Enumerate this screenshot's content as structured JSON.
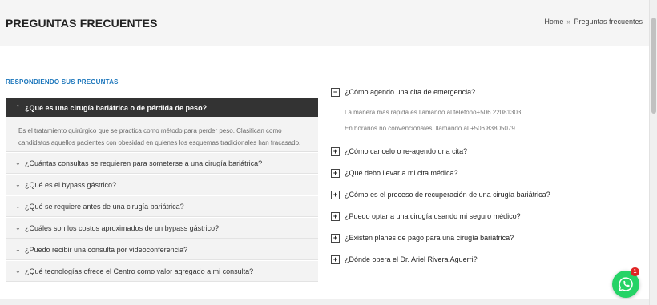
{
  "header": {
    "title": "PREGUNTAS FRECUENTES",
    "breadcrumb_home": "Home",
    "breadcrumb_separator": "»",
    "breadcrumb_current": "Preguntas frecuentes"
  },
  "section": {
    "label": "RESPONDIENDO SUS PREGUNTAS"
  },
  "left_faq": {
    "open_question": "¿Qué es una cirugía bariátrica o de pérdida de peso?",
    "open_answer": "Es el tratamiento quirúrgico que se practica como método para perder peso. Clasifican como candidatos aquellos pacientes con obesidad en quienes los esquemas tradicionales han fracasado.",
    "items": [
      "¿Cuántas consultas se requieren para someterse a una cirugía bariátrica?",
      "¿Qué es el bypass gástrico?",
      "¿Qué se requiere antes de una cirugía bariátrica?",
      "¿Cuáles son los costos aproximados de un bypass gástrico?",
      "¿Puedo recibir una consulta por videoconferencia?",
      "¿Qué tecnologías ofrece el Centro como valor agregado a mi consulta?"
    ]
  },
  "right_faq": {
    "open_question": "¿Cómo agendo una cita de emergencia?",
    "open_answer_lines": [
      "La manera más rápida es llamando al teléfono+506 22081303",
      "En horarios no convencionales, llamando al +506 83805079"
    ],
    "items": [
      "¿Cómo cancelo o re-agendo una cita?",
      "¿Qué debo llevar a mi cita médica?",
      "¿Cómo es el proceso de recuperación de una cirugía bariátrica?",
      "¿Puedo optar a una cirugía usando mi seguro médico?",
      "¿Existen planes de pago para una cirugía bariátrica?",
      "¿Dónde opera el Dr. Ariel Rivera Aguerri?"
    ],
    "expanded_icon": "−",
    "collapsed_icon": "+"
  },
  "chat_widget": {
    "icon": "whatsapp-icon",
    "badge_count": "1",
    "color": "#25d366"
  },
  "colors": {
    "accent": "#1a75bb",
    "open_header": "#333333",
    "panel_bg": "#f3f3f3"
  }
}
